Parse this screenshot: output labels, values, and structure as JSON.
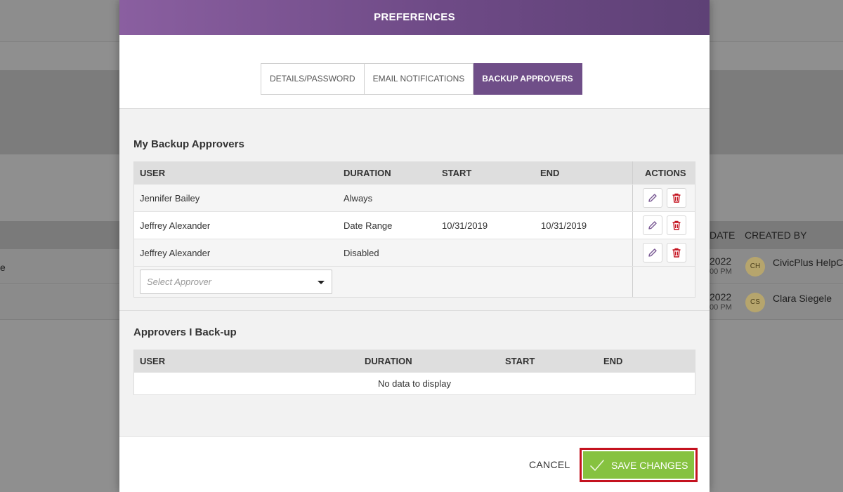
{
  "background": {
    "columns": {
      "date": "DATE",
      "created_by": "CREATED BY"
    },
    "rows": [
      {
        "year": "2022",
        "time": "00 PM",
        "initials": "CH",
        "creator": "CivicPlus HelpCe",
        "left_char": "e"
      },
      {
        "year": "2022",
        "time": "00 PM",
        "initials": "CS",
        "creator": "Clara Siegele"
      }
    ]
  },
  "modal": {
    "title": "PREFERENCES",
    "tabs": [
      {
        "label": "DETAILS/PASSWORD",
        "active": false
      },
      {
        "label": "EMAIL NOTIFICATIONS",
        "active": false
      },
      {
        "label": "BACKUP APPROVERS",
        "active": true
      }
    ],
    "my_backups": {
      "title": "My Backup Approvers",
      "columns": {
        "user": "USER",
        "duration": "DURATION",
        "start": "START",
        "end": "END",
        "actions": "ACTIONS"
      },
      "rows": [
        {
          "user": "Jennifer Bailey",
          "duration": "Always",
          "start": "",
          "end": ""
        },
        {
          "user": "Jeffrey Alexander",
          "duration": "Date Range",
          "start": "10/31/2019",
          "end": "10/31/2019"
        },
        {
          "user": "Jeffrey Alexander",
          "duration": "Disabled",
          "start": "",
          "end": ""
        }
      ],
      "select_placeholder": "Select Approver"
    },
    "i_backup": {
      "title": "Approvers I Back-up",
      "columns": {
        "user": "USER",
        "duration": "DURATION",
        "start": "START",
        "end": "END"
      },
      "empty_text": "No data to display"
    },
    "footer": {
      "cancel_label": "CANCEL",
      "save_label": "SAVE CHANGES"
    }
  },
  "colors": {
    "header": "#6e4a86",
    "active_tab": "#6f4e88",
    "save": "#86c240",
    "highlight": "#c4121f",
    "delete_icon": "#c4121f",
    "edit_icon": "#7a5a94"
  }
}
